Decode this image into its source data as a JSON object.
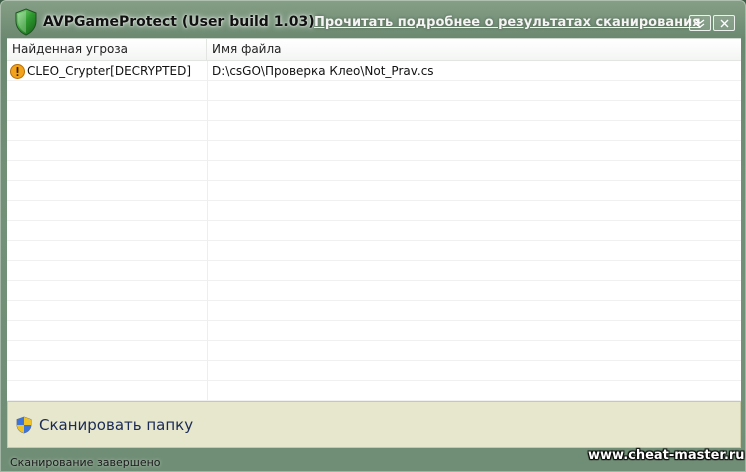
{
  "window": {
    "title": "AVPGameProtect (User build 1.03)",
    "details_link": "Прочитать подробнее о результатах сканирования",
    "controls": {
      "minimize_icon": "chevron-down-double-icon",
      "close_icon": "close-icon"
    }
  },
  "table": {
    "columns": [
      "Найденная угроза",
      "Имя файла"
    ],
    "rows": [
      {
        "icon": "warning-icon",
        "threat": "CLEO_Crypter[DECRYPTED]",
        "file": "D:\\csGO\\Проверка Клео\\Not_Prav.cs"
      }
    ]
  },
  "action": {
    "scan_label": "Сканировать папку",
    "icon": "uac-shield-icon"
  },
  "status": {
    "text": "Сканирование завершено"
  },
  "watermark": "www.cheat-master.ru",
  "colors": {
    "action_bar": "#e6e7cd",
    "warning": "#f2a31b",
    "shield_green": "#2e9a2e"
  }
}
